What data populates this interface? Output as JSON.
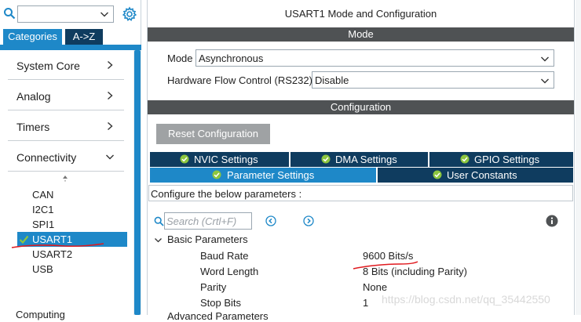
{
  "left_panel": {
    "category_select_value": "",
    "tabs": {
      "categories": "Categories",
      "az": "A->Z"
    },
    "categories": [
      {
        "label": "System Core"
      },
      {
        "label": "Analog"
      },
      {
        "label": "Timers"
      },
      {
        "label": "Connectivity"
      }
    ],
    "peripherals": [
      {
        "label": "CAN",
        "selected": false
      },
      {
        "label": "I2C1",
        "selected": false
      },
      {
        "label": "SPI1",
        "selected": false
      },
      {
        "label": "USART1",
        "selected": true
      },
      {
        "label": "USART2",
        "selected": false
      },
      {
        "label": "USB",
        "selected": false
      }
    ],
    "bottom_partial_text": "Computing"
  },
  "right_panel": {
    "title": "USART1 Mode and Configuration",
    "mode_bar": "Mode",
    "mode": {
      "mode_label": "Mode",
      "mode_value": "Asynchronous",
      "flow_label": "Hardware Flow Control (RS232)",
      "flow_value": "Disable"
    },
    "configuration_bar": "Configuration",
    "reset_button": "Reset Configuration",
    "tabs": {
      "nvic": "NVIC Settings",
      "dma": "DMA Settings",
      "gpio": "GPIO Settings",
      "parameter": "Parameter Settings",
      "user_constants": "User Constants"
    },
    "subheader": "Configure the below parameters :",
    "search_placeholder": "Search (Crtl+F)",
    "section_title": "Basic Parameters",
    "parameters": [
      {
        "name": "Baud Rate",
        "value": "9600 Bits/s"
      },
      {
        "name": "Word Length",
        "value": "8 Bits (including Parity)"
      },
      {
        "name": "Parity",
        "value": "None"
      },
      {
        "name": "Stop Bits",
        "value": "1"
      }
    ],
    "next_section_partial": "Advanced Parameters"
  },
  "watermark": "https://blog.csdn.net/qq_35442550",
  "colors": {
    "accent_blue": "#1e88c8",
    "dark_navy": "#0f3c5f",
    "bar_gray": "#4f5254",
    "button_gray": "#9fa2a4",
    "check_green": "#8dc63f",
    "annotation_red": "#e0191e"
  },
  "icons": {
    "search": "search-icon",
    "gear": "gear-icon",
    "chevron_right": "chevron-right-icon",
    "chevron_down": "chevron-down-icon",
    "check": "check-circle-icon",
    "info": "info-icon"
  }
}
